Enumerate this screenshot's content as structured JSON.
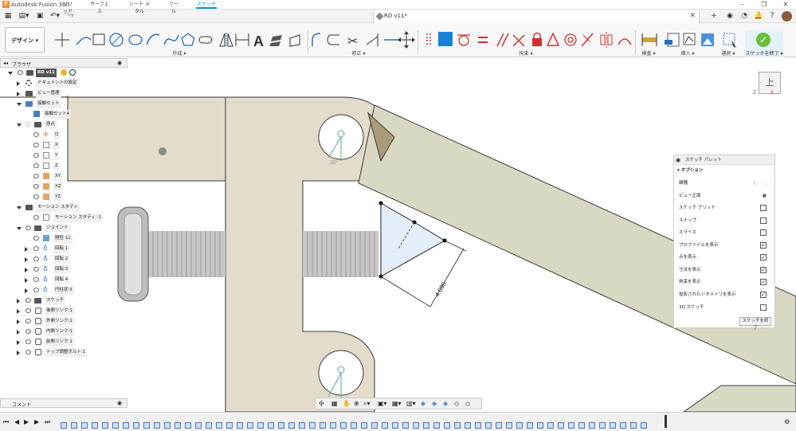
{
  "app": {
    "title": "Autodesk Fusion 360",
    "logo_letter": "F"
  },
  "document": {
    "title": "RD v11*"
  },
  "ribbon": {
    "tabs": [
      {
        "label": "ソリッド"
      },
      {
        "label": "サーフェス"
      },
      {
        "label": "シート メタル"
      },
      {
        "label": "ツール"
      },
      {
        "label": "スケッチ"
      }
    ],
    "active_tab": "スケッチ",
    "workspace": "デザイン ▾",
    "groups": {
      "create": "作成 ▾",
      "modify": "修正 ▾",
      "constraints": "拘束 ▾",
      "inspect": "検査 ▾",
      "insert": "挿入 ▾",
      "select": "選択 ▾",
      "finish": "スケッチを終了 ▾"
    }
  },
  "browser": {
    "title": "ブラウザ",
    "rows": [
      {
        "label": "RD v11"
      },
      {
        "label": "ドキュメントの設定"
      },
      {
        "label": "ビュー管理"
      },
      {
        "label": "原点"
      },
      {
        "label": "接触セット"
      },
      {
        "label": "接触セット4"
      },
      {
        "label": "原点"
      },
      {
        "label": "O"
      },
      {
        "label": "X"
      },
      {
        "label": "Y"
      },
      {
        "label": "Z"
      },
      {
        "label": "XY"
      },
      {
        "label": "XZ"
      },
      {
        "label": "YZ"
      },
      {
        "label": "モーション スタディ"
      },
      {
        "label": "モーション スタディ -1"
      },
      {
        "label": "ジョイント"
      },
      {
        "label": "剛性 11"
      },
      {
        "label": "回転 1"
      },
      {
        "label": "回転 2"
      },
      {
        "label": "回転 3"
      },
      {
        "label": "回転 4"
      },
      {
        "label": "円柱状 5"
      },
      {
        "label": "スケッチ"
      },
      {
        "label": "後側リンク:1"
      },
      {
        "label": "外側リンク:1"
      },
      {
        "label": "内側リンク:1"
      },
      {
        "label": "前側リンク:1"
      },
      {
        "label": "トップ調整ボルト:1"
      }
    ]
  },
  "comments": {
    "title": "コメント"
  },
  "viewcube": {
    "face": "上",
    "axis_x": "X",
    "axis_z": "Z"
  },
  "canvas": {
    "dimension_text": "4.096",
    "angle_text": "30°"
  },
  "sketch_palette": {
    "title": "スケッチ パレット",
    "section": "オプション",
    "options": [
      {
        "label": "線種",
        "checked": null
      },
      {
        "label": "ビュー正面",
        "checked": null
      },
      {
        "label": "スケッチ グリッド",
        "checked": false
      },
      {
        "label": "スナップ",
        "checked": false
      },
      {
        "label": "スライス",
        "checked": false
      },
      {
        "label": "プロファイルを表示",
        "checked": true
      },
      {
        "label": "点を表示",
        "checked": true
      },
      {
        "label": "寸法を表示",
        "checked": true
      },
      {
        "label": "拘束を表示",
        "checked": true
      },
      {
        "label": "投影されたジオメトリを表示",
        "checked": true
      },
      {
        "label": "3D スケッチ",
        "checked": false
      }
    ],
    "finish_button": "スケッチを終了"
  },
  "colors": {
    "part_fill": "#e3dccb",
    "part_stroke": "#3a3a3a",
    "link_fill": "#d9d8c2",
    "accent": "#0696d7",
    "finish_green": "#6bbf3a"
  }
}
